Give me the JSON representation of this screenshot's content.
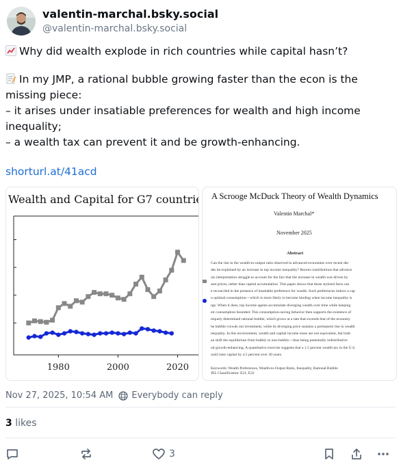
{
  "author": {
    "display_name": "valentin-marchal.bsky.social",
    "handle": "@valentin-marchal.bsky.social"
  },
  "post": {
    "line1": "Why did wealth explode in rich countries while capital hasn’t?",
    "line1_icon": "chart-increasing-emoji",
    "line2": "In my JMP, a rational bubble growing faster than the econ is the missing piece:",
    "line2_icon": "memo-emoji",
    "bullet1": "– it arises under insatiable preferences for wealth and high income inequality;",
    "bullet2": "– a wealth tax can prevent it and be growth-enhancing.",
    "link": "shorturl.at/41acd"
  },
  "image_left": {
    "title": "Wealth and Capital for G7 countrie",
    "chart_data": {
      "type": "line",
      "title": "Wealth and Capital for G7 countrie",
      "xlabel": "",
      "ylabel": "",
      "xlim": [
        1965,
        2027
      ],
      "xticks": [
        "1980",
        "2000",
        "2020"
      ],
      "ylim": [
        0,
        10
      ],
      "grid": false,
      "series": [
        {
          "color": "#888888",
          "marker": "square",
          "x": [
            1970,
            1972,
            1974,
            1976,
            1978,
            1980,
            1982,
            1984,
            1986,
            1988,
            1990,
            1992,
            1994,
            1996,
            1998,
            2000,
            2002,
            2004,
            2006,
            2008,
            2010,
            2012,
            2014,
            2016,
            2018,
            2020,
            2022
          ],
          "y": [
            2.3,
            2.45,
            2.4,
            2.35,
            2.5,
            3.4,
            3.7,
            3.5,
            3.9,
            3.8,
            4.2,
            4.5,
            4.4,
            4.4,
            4.3,
            4.1,
            4.0,
            4.4,
            5.1,
            5.6,
            4.7,
            4.2,
            4.6,
            5.4,
            6.1,
            7.4,
            6.8
          ]
        },
        {
          "color": "#1428d6",
          "marker": "circle",
          "x": [
            1970,
            1972,
            1974,
            1976,
            1978,
            1980,
            1982,
            1984,
            1986,
            1988,
            1990,
            1992,
            1994,
            1996,
            1998,
            2000,
            2002,
            2004,
            2006,
            2008,
            2010,
            2012,
            2014,
            2016,
            2018
          ],
          "y": [
            1.25,
            1.35,
            1.3,
            1.55,
            1.6,
            1.45,
            1.55,
            1.7,
            1.65,
            1.55,
            1.5,
            1.45,
            1.55,
            1.55,
            1.6,
            1.55,
            1.5,
            1.6,
            1.55,
            1.9,
            1.85,
            1.75,
            1.7,
            1.6,
            1.55
          ]
        }
      ]
    }
  },
  "image_right": {
    "title": "A Scrooge McDuck Theory of Wealth Dynamics",
    "author": "Valentin Marchal*",
    "date": "November 2025",
    "abstract_heading": "Abstract",
    "abstract_lines": [
      "Can the rise in the wealth-to-output ratio observed in advanced economies over recent dec",
      "des be explained by an increase in top income inequality? Recent contributions that advance",
      "ois interpretation struggle to account for the fact that the increase in wealth was driven by",
      "sset prices, rather than capital accumulation. This paper shows that these stylized facts can",
      "e reconciled in the presence of insatiable preference for wealth. Such preferences induce a cap",
      "n optimal consumption—which is more likely to become binding when income inequality is",
      "rge. When it does, top income agents accumulate diverging wealth over time while keeping",
      "eir consumption bounded. This consumption-saving behavior then supports the existence of",
      "niquely determined rational bubble, which grows at a rate that exceeds that of the economy",
      "he bubble crowds out investment, while its diverging price sustains a permanent rise in wealth",
      "nequality. In this environment, wealth and capital income taxes are not equivalent, but both",
      "an shift the equilibrium from bubbly to non-bubbly—thus being potentially redistributive",
      "nd growth-enhancing. A quantitative exercise suggests that a 1.5 percent wealth tax in the U.S.",
      "ould raise capital by 4.5 percent over 30 years."
    ],
    "keywords": "Keywords: Wealth Preferences, Wealth-to-Output Ratio, Inequality, Rational Bubble",
    "jel": "JEL Classification: E21, E22"
  },
  "meta": {
    "timestamp": "Nov 27, 2025, 10:54 AM",
    "reply_setting": "Everybody can reply"
  },
  "stats": {
    "likes_count": "3",
    "likes_label": "likes"
  },
  "actions": {
    "like_count": "3"
  },
  "colors": {
    "link": "#1f6ed4",
    "muted": "#5b6775",
    "wealth_series": "#888888",
    "capital_series": "#1428d6"
  }
}
